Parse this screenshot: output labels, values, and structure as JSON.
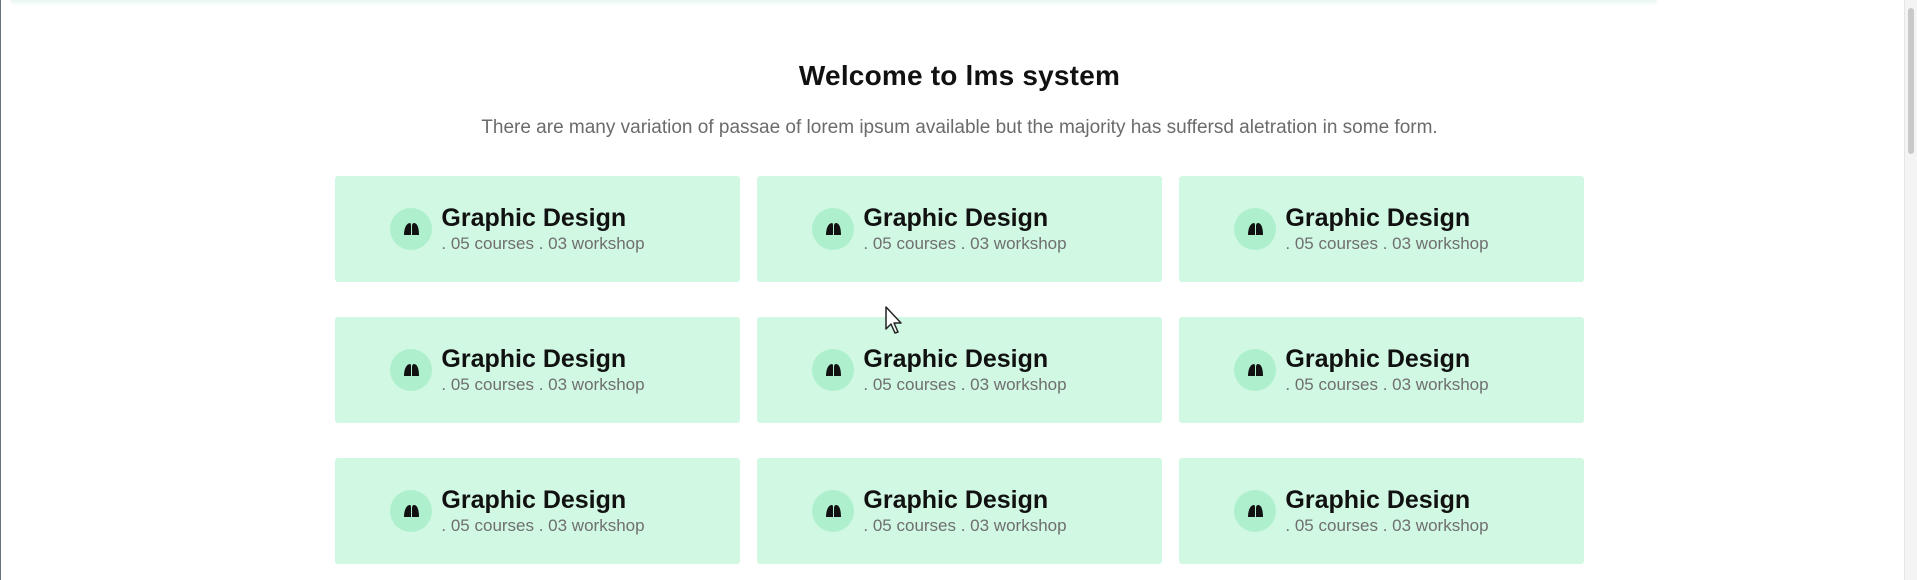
{
  "header": {
    "title": "Welcome to lms system",
    "subtitle": "There are many variation of passae of lorem ipsum available but the majority has suffersd aletration in some form."
  },
  "categories": {
    "icon": "category-icon",
    "items": [
      {
        "title": "Graphic Design",
        "meta": ". 05 courses . 03 workshop"
      },
      {
        "title": "Graphic Design",
        "meta": ". 05 courses . 03 workshop"
      },
      {
        "title": "Graphic Design",
        "meta": ". 05 courses . 03 workshop"
      },
      {
        "title": "Graphic Design",
        "meta": ". 05 courses . 03 workshop"
      },
      {
        "title": "Graphic Design",
        "meta": ". 05 courses . 03 workshop"
      },
      {
        "title": "Graphic Design",
        "meta": ". 05 courses . 03 workshop"
      },
      {
        "title": "Graphic Design",
        "meta": ". 05 courses . 03 workshop"
      },
      {
        "title": "Graphic Design",
        "meta": ". 05 courses . 03 workshop"
      },
      {
        "title": "Graphic Design",
        "meta": ". 05 courses . 03 workshop"
      }
    ]
  },
  "colors": {
    "card_background": "#d1f8e3",
    "icon_background": "#aef0cd",
    "title_text": "#111111",
    "muted_text": "#6b6b6b"
  }
}
